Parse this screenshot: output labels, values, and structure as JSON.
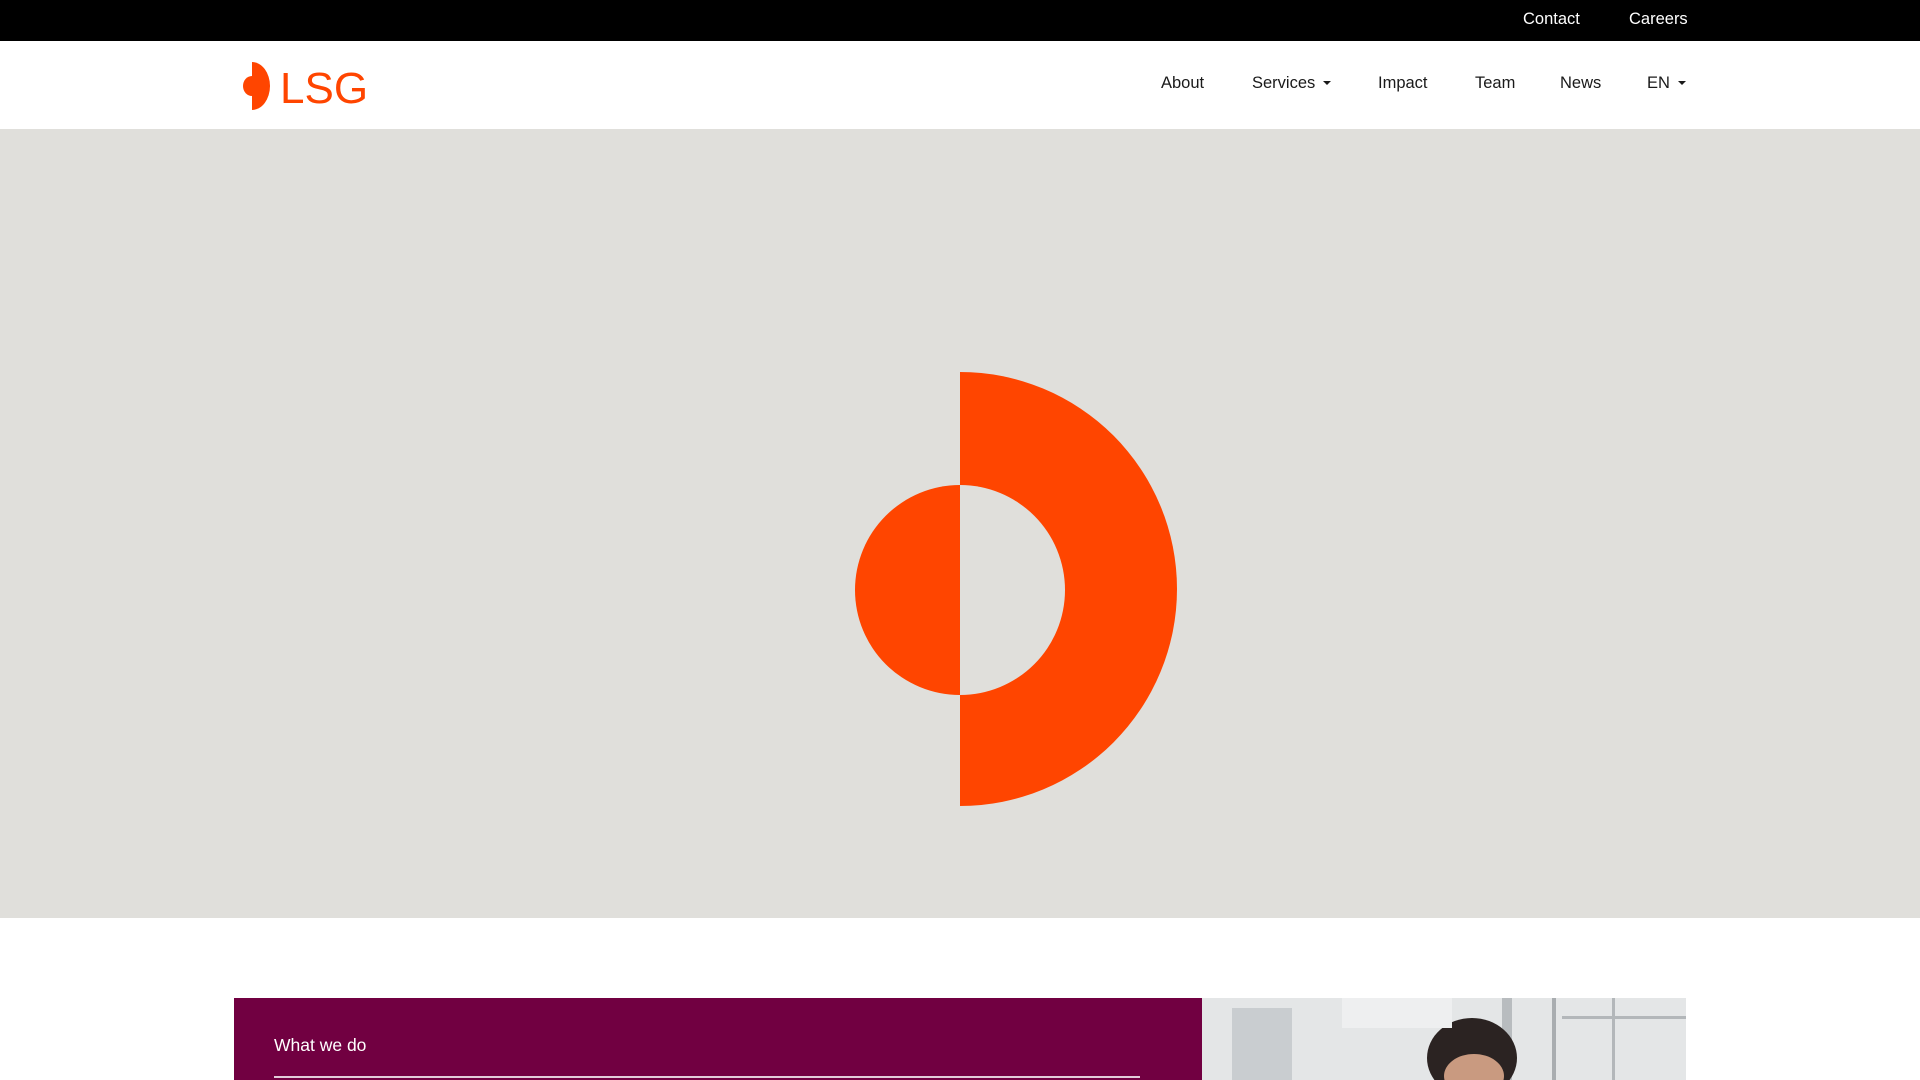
{
  "colors": {
    "brand_orange": "#ff4500",
    "brand_purple": "#710041",
    "topbar_bg": "#000000",
    "hero_bg": "#e0dfdb"
  },
  "topbar": {
    "contact_label": "Contact",
    "careers_label": "Careers"
  },
  "header": {
    "logo": {
      "icon": "lsg-mark-icon",
      "text": "LSG"
    },
    "nav": {
      "about": "About",
      "services": "Services",
      "impact": "Impact",
      "team": "Team",
      "news": "News",
      "language": "EN"
    }
  },
  "hero": {
    "graphic": "lsg-brand-mark-icon"
  },
  "section": {
    "eyebrow": "What we do",
    "image": "woman-at-office-photo"
  }
}
